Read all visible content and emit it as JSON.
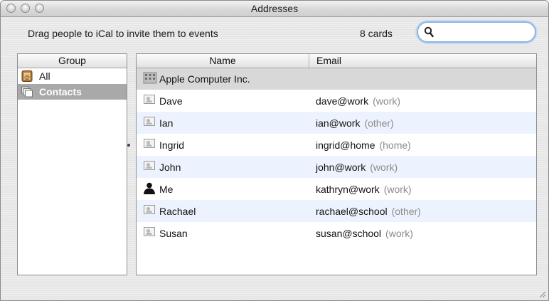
{
  "window": {
    "title": "Addresses"
  },
  "toolbar": {
    "hint": "Drag people to iCal to invite them to events",
    "card_count": "8 cards",
    "search": {
      "value": "",
      "placeholder": ""
    }
  },
  "groups": {
    "header": "Group",
    "items": [
      {
        "label": "All",
        "icon": "all-group-icon",
        "selected": false
      },
      {
        "label": "Contacts",
        "icon": "group-folder-icon",
        "selected": true
      }
    ]
  },
  "people": {
    "headers": {
      "name": "Name",
      "email": "Email"
    },
    "company": {
      "name": "Apple Computer Inc."
    },
    "rows": [
      {
        "name": "Dave",
        "email": "dave@work",
        "type": "(work)"
      },
      {
        "name": "Ian",
        "email": "ian@work",
        "type": "(other)"
      },
      {
        "name": "Ingrid",
        "email": "ingrid@home",
        "type": "(home)"
      },
      {
        "name": "John",
        "email": "john@work",
        "type": "(work)"
      },
      {
        "name": "Me",
        "email": "kathryn@work",
        "type": "(work)"
      },
      {
        "name": "Rachael",
        "email": "rachael@school",
        "type": "(other)"
      },
      {
        "name": "Susan",
        "email": "susan@school",
        "type": "(work)"
      }
    ]
  },
  "colors": {
    "selection_gray": "#a9a9a9",
    "stripe_blue": "#edf3fe",
    "focus_ring": "#8fb4de"
  }
}
